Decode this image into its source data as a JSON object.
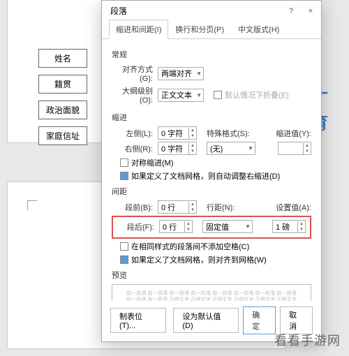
{
  "doc": {
    "labels": [
      "姓名",
      "籍贯",
      "政治面貌",
      "家庭信址"
    ],
    "wm_blue1": "丄",
    "wm_blue2": "育"
  },
  "dialog": {
    "title": "段落",
    "help": "?",
    "close": "×",
    "tabs": {
      "t1": "缩进和间距(I)",
      "t2": "换行和分页(P)",
      "t3": "中文版式(H)"
    },
    "general": {
      "heading": "常规",
      "align_lbl": "对齐方式(G):",
      "align_val": "两端对齐",
      "outline_lbl": "大纲级别(O):",
      "outline_val": "正文文本",
      "collapse_chk": "默认情况下折叠(E)"
    },
    "indent": {
      "heading": "缩进",
      "left_lbl": "左侧(L):",
      "left_val": "0 字符",
      "right_lbl": "右侧(R):",
      "right_val": "0 字符",
      "special_lbl": "特殊格式(S):",
      "special_val": "(无)",
      "by_lbl": "缩进值(Y):",
      "by_val": "",
      "mirror_chk": "对称缩进(M)",
      "autogrid_chk": "如果定义了文档网格，则自动调整右缩进(D)"
    },
    "spacing": {
      "heading": "间距",
      "before_lbl": "段前(B):",
      "before_val": "0 行",
      "after_lbl": "段后(F):",
      "after_val": "0 行",
      "line_lbl": "行距(N):",
      "line_val": "固定值",
      "at_lbl": "设置值(A):",
      "at_val": "1 磅",
      "nospace_chk": "在相同样式的段落间不添加空格(C)",
      "snapgrid_chk": "如果定义了文档网格，则对齐到网格(W)"
    },
    "preview": {
      "heading": "预览",
      "text": "前一段落 前一段落 前一段落 前一段落 前一段落 前一段落 前一段落 前一段落 前一段落 前一段落 示例文字 示例文字 示例文字 示例文字 示例文字 示例文字 示例文字 示例文字 示例文字 示例文字 示例文字 示例文字 示例文字 下一段落 下一段落 下一段落 下一段落 下一段落 下一段落 下一段落 下一段落"
    },
    "footer": {
      "tabs_btn": "制表位(T)...",
      "default_btn": "设为默认值(D)",
      "ok_btn": "确定",
      "cancel_btn": "取消"
    }
  },
  "watermark": "看看手游网"
}
